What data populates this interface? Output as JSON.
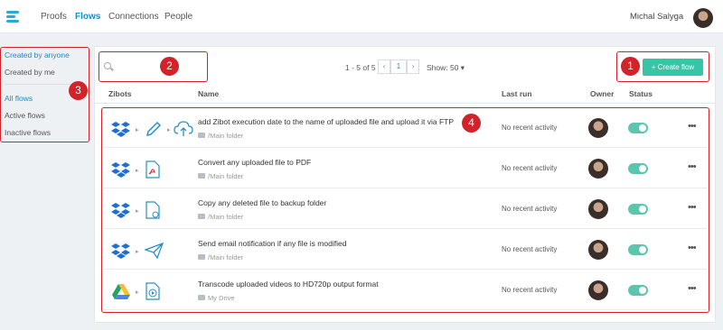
{
  "nav": {
    "links": [
      "Proofs",
      "Flows",
      "Connections",
      "People"
    ],
    "user_name": "Michal Salyga"
  },
  "sidebar": {
    "items": [
      "Created by anyone",
      "Created by me",
      "All flows",
      "Active flows",
      "Inactive flows"
    ]
  },
  "toolbar": {
    "search_placeholder": "",
    "pager_range": "1 - 5 of 5",
    "prev": "‹",
    "page": "1",
    "next": "›",
    "show_label": "Show: 50 ▾",
    "create_label": "+ Create flow"
  },
  "table": {
    "headers": [
      "Zibots",
      "Name",
      "Last run",
      "Owner",
      "Status"
    ]
  },
  "rows": [
    {
      "name": "add Zibot execution date to the name of uploaded file and upload it via FTP",
      "folder": "/Main folder",
      "last_run": "No recent activity",
      "source_icon": "dropbox-icon",
      "target_icon": "ftp-upload-icon",
      "status_on": true
    },
    {
      "name": "Convert any uploaded file to PDF",
      "folder": "/Main folder",
      "last_run": "No recent activity",
      "source_icon": "dropbox-icon",
      "target_icon": "pdf-icon",
      "status_on": true
    },
    {
      "name": "Copy any deleted file to backup folder",
      "folder": "/Main folder",
      "last_run": "No recent activity",
      "source_icon": "dropbox-icon",
      "target_icon": "file-copy-icon",
      "status_on": true
    },
    {
      "name": "Send email notification if any file is modified",
      "folder": "/Main folder",
      "last_run": "No recent activity",
      "source_icon": "dropbox-icon",
      "target_icon": "email-send-icon",
      "status_on": true
    },
    {
      "name": "Transcode uploaded videos to HD720p output format",
      "folder": "My Drive",
      "last_run": "No recent activity",
      "source_icon": "google-drive-icon",
      "target_icon": "video-file-icon",
      "status_on": true
    }
  ],
  "annotations": [
    "1",
    "2",
    "3",
    "4"
  ],
  "colors": {
    "accent": "#1f8ac0",
    "create_button": "#36c5a5",
    "toggle": "#5bc6ad",
    "callout": "#d2232a"
  }
}
